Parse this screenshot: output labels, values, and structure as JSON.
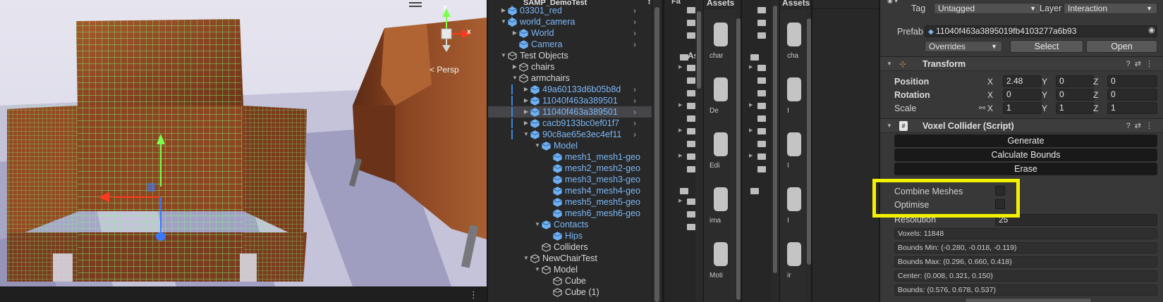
{
  "scene_view": {
    "persp_label": "< Persp",
    "gizmo_x_label": "x",
    "gizmo_y_label": "y",
    "kebab": "⋮",
    "colors": {
      "sky": "#dcdbe7",
      "floor_light": "#c9c8de",
      "floor_dark": "#9997bb",
      "wood": "#8e4a24",
      "wire": "#7dff7d"
    }
  },
  "hierarchy": {
    "scene_name": "SAMP_DemoTest",
    "kebab": "⋮",
    "rows": [
      {
        "label": "03301_red",
        "kind": "prefab",
        "depth": 1,
        "expand": "closed",
        "chevron": true,
        "bar": true
      },
      {
        "label": "world_camera",
        "kind": "prefab",
        "depth": 1,
        "expand": "open",
        "chevron": true,
        "bar": true
      },
      {
        "label": "World",
        "kind": "prefab",
        "depth": 2,
        "expand": "closed",
        "chevron": true,
        "bar": false
      },
      {
        "label": "Camera",
        "kind": "prefab",
        "depth": 2,
        "expand": "none",
        "chevron": true,
        "bar": false
      },
      {
        "label": "Test Objects",
        "kind": "plain",
        "depth": 1,
        "expand": "open",
        "chevron": false,
        "bar": false
      },
      {
        "label": "chairs",
        "kind": "plain",
        "depth": 2,
        "expand": "closed",
        "chevron": false,
        "bar": false
      },
      {
        "label": "armchairs",
        "kind": "plain",
        "depth": 2,
        "expand": "open",
        "chevron": false,
        "bar": false
      },
      {
        "label": "49a60133d6b05b8d",
        "kind": "prefab",
        "depth": 3,
        "expand": "closed",
        "chevron": true,
        "bar": true
      },
      {
        "label": "11040f463a389501",
        "kind": "prefab",
        "depth": 3,
        "expand": "closed",
        "chevron": true,
        "bar": true
      },
      {
        "label": "11040f463a389501",
        "kind": "prefab",
        "depth": 3,
        "expand": "closed",
        "chevron": true,
        "bar": true,
        "selected": true
      },
      {
        "label": "cacb9133bc0ef01f7",
        "kind": "prefab",
        "depth": 3,
        "expand": "closed",
        "chevron": true,
        "bar": true
      },
      {
        "label": "90c8ae65e3ec4ef11",
        "kind": "prefab",
        "depth": 3,
        "expand": "open",
        "chevron": true,
        "bar": true
      },
      {
        "label": "Model",
        "kind": "prefab",
        "depth": 4,
        "expand": "open",
        "chevron": false,
        "bar": false
      },
      {
        "label": "mesh1_mesh1-geo",
        "kind": "prefab",
        "depth": 5,
        "expand": "none",
        "chevron": false,
        "bar": false
      },
      {
        "label": "mesh2_mesh2-geo",
        "kind": "prefab",
        "depth": 5,
        "expand": "none",
        "chevron": false,
        "bar": false
      },
      {
        "label": "mesh3_mesh3-geo",
        "kind": "prefab",
        "depth": 5,
        "expand": "none",
        "chevron": false,
        "bar": false
      },
      {
        "label": "mesh4_mesh4-geo",
        "kind": "prefab",
        "depth": 5,
        "expand": "none",
        "chevron": false,
        "bar": false
      },
      {
        "label": "mesh5_mesh5-geo",
        "kind": "prefab",
        "depth": 5,
        "expand": "none",
        "chevron": false,
        "bar": false
      },
      {
        "label": "mesh6_mesh6-geo",
        "kind": "prefab",
        "depth": 5,
        "expand": "none",
        "chevron": false,
        "bar": false
      },
      {
        "label": "Contacts",
        "kind": "prefab",
        "depth": 4,
        "expand": "open",
        "chevron": false,
        "bar": false
      },
      {
        "label": "Hips",
        "kind": "prefab",
        "depth": 5,
        "expand": "none",
        "chevron": false,
        "bar": false
      },
      {
        "label": "Colliders",
        "kind": "plain",
        "depth": 4,
        "expand": "none",
        "chevron": false,
        "bar": false
      },
      {
        "label": "NewChairTest",
        "kind": "plain",
        "depth": 3,
        "expand": "open",
        "chevron": false,
        "bar": false
      },
      {
        "label": "Model",
        "kind": "plain",
        "depth": 4,
        "expand": "open",
        "chevron": false,
        "bar": false
      },
      {
        "label": "Cube",
        "kind": "plain",
        "depth": 5,
        "expand": "none",
        "chevron": false,
        "bar": false
      },
      {
        "label": "Cube (1)",
        "kind": "plain",
        "depth": 5,
        "expand": "none",
        "chevron": false,
        "bar": false
      }
    ]
  },
  "project1": {
    "header_tree": "Fa",
    "header_assets": "Assets",
    "tree_folder_label": "As",
    "tile_labels": [
      "char",
      "De",
      "Edi",
      "ima",
      "Moti"
    ]
  },
  "project2": {
    "header_assets": "Assets",
    "tile_labels": [
      "cha",
      "I",
      "I",
      "I",
      "ir"
    ]
  },
  "inspector": {
    "tag_label": "Tag",
    "tag_value": "Untagged",
    "layer_label": "Layer",
    "layer_value": "Interaction",
    "prefab_label": "Prefab",
    "prefab_value": "11040f463a3895019fb4103277a6b93",
    "overrides_label": "Overrides",
    "select_label": "Select",
    "open_label": "Open",
    "transform": {
      "title": "Transform",
      "position_label": "Position",
      "rotation_label": "Rotation",
      "scale_label": "Scale",
      "position": {
        "x": "2.48",
        "y": "0",
        "z": "0"
      },
      "rotation": {
        "x": "0",
        "y": "0",
        "z": "0"
      },
      "scale": {
        "x": "1",
        "y": "1",
        "z": "1"
      }
    },
    "voxel_collider": {
      "title": "Voxel Collider (Script)",
      "generate_label": "Generate",
      "calculate_bounds_label": "Calculate Bounds",
      "erase_label": "Erase",
      "combine_meshes_label": "Combine Meshes",
      "combine_meshes_checked": false,
      "optimise_label": "Optimise",
      "optimise_checked": false,
      "resolution_label": "Resolution",
      "resolution_value": "25",
      "voxels_text": "Voxels: 11848",
      "bounds_min_text": "Bounds Min: (-0.280, -0.018, -0.119)",
      "bounds_max_text": "Bounds Max: (0.296, 0.660, 0.418)",
      "center_text": "Center: (0.008, 0.321, 0.150)",
      "bounds_text": "Bounds: (0.576, 0.678, 0.537)"
    },
    "highlight_color": "#f2f200"
  }
}
